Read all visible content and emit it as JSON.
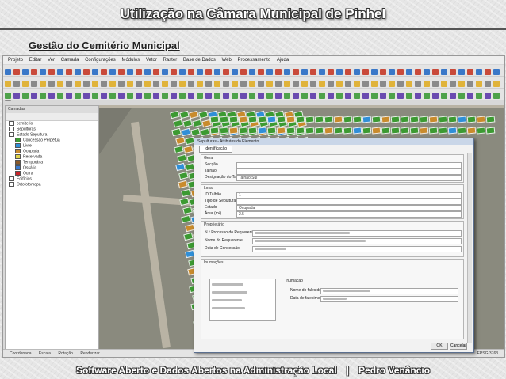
{
  "slide": {
    "title": "Utilização na Câmara Municipal de Pinhel",
    "subtitle": "Gestão do Cemitério Municipal",
    "footer_left": "Software Aberto e Dados Abertos na Administração Local",
    "footer_sep": "|",
    "footer_right": "Pedro Venâncio"
  },
  "qgis": {
    "menu": [
      "Projeto",
      "Editar",
      "Ver",
      "Camada",
      "Configurações",
      "Módulos",
      "Vetor",
      "Raster",
      "Base de Dados",
      "Web",
      "Processamento",
      "Ajuda"
    ],
    "layers_panel": {
      "title": "Camadas",
      "items": [
        {
          "label": "cemiterio",
          "color": "#ffffff"
        },
        {
          "label": "Sepulturas",
          "color": "#ffffff"
        },
        {
          "label": "Estado Sepultura",
          "color": "#ffffff"
        },
        {
          "label": "Concessão Perpétua",
          "color": "#3c9a32"
        },
        {
          "label": "Livre",
          "color": "#2f8fd8"
        },
        {
          "label": "Ocupada",
          "color": "#c98b2c"
        },
        {
          "label": "Reservada",
          "color": "#e0d44a"
        },
        {
          "label": "Temporária",
          "color": "#8a5a2b"
        },
        {
          "label": "Ossário",
          "color": "#3a7ad0"
        },
        {
          "label": "Outra",
          "color": "#c9262b"
        },
        {
          "label": "Edifícios",
          "color": "#ffffff"
        },
        {
          "label": "Ortofotomapa",
          "color": "#ffffff"
        }
      ]
    },
    "status": {
      "coord": "Coordenada",
      "scale": "Escala",
      "rotation": "Rotação",
      "render": "Renderizar",
      "crs": "EPSG:3763"
    },
    "dialog": {
      "title": "Sepulturas - Atributos do Elemento",
      "tab": "Identificação",
      "groups": {
        "general": "Geral",
        "location": "Local",
        "owner": "Proprietário",
        "burials": "Inumações"
      },
      "fields": {
        "section": "Secção",
        "row": "Talhão",
        "number": "Número",
        "designation": "Designação do Talhão",
        "designation_value": "Talhão Sul",
        "id": "ID Talhão",
        "id_value": "1",
        "type": "Tipo de Sepultura",
        "state": "Estado",
        "state_value": "Ocupada",
        "area": "Área (m²)",
        "area_value": "2.5",
        "owner_name": "N.º Processo do Requerente",
        "owner_address": "Nome do Requerente",
        "owner_date": "Data de Concessão",
        "burial_header": "Nome do falecido",
        "burial_detail": "Inumação",
        "burial_name": "Nome do falecido",
        "burial_date": "Data de falecimento"
      },
      "buttons": {
        "ok": "OK",
        "cancel": "Cancelar"
      }
    }
  }
}
